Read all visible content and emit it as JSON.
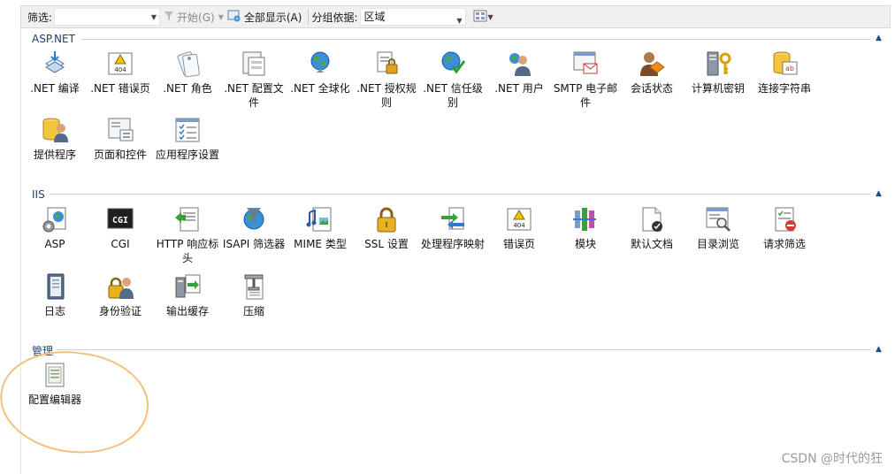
{
  "toolbar": {
    "filter_label": "筛选:",
    "filter_value": "",
    "start_label": "开始(G)",
    "show_all_label": "全部显示(A)",
    "group_label": "分组依据:",
    "group_value": "区域"
  },
  "sections": [
    {
      "title": "ASP.NET",
      "items": [
        {
          "label": ".NET 编译",
          "icon": "compile-icon"
        },
        {
          "label": ".NET 错误页",
          "icon": "error-page-404-icon"
        },
        {
          "label": ".NET 角色",
          "icon": "roles-icon"
        },
        {
          "label": ".NET 配置文件",
          "icon": "profile-icon"
        },
        {
          "label": ".NET 全球化",
          "icon": "globe-icon"
        },
        {
          "label": ".NET 授权规则",
          "icon": "authorization-icon"
        },
        {
          "label": ".NET 信任级别",
          "icon": "trust-level-icon"
        },
        {
          "label": ".NET 用户",
          "icon": "users-icon"
        },
        {
          "label": "SMTP 电子邮件",
          "icon": "smtp-email-icon"
        },
        {
          "label": "会话状态",
          "icon": "session-state-icon"
        },
        {
          "label": "计算机密钥",
          "icon": "machine-key-icon"
        },
        {
          "label": "连接字符串",
          "icon": "connection-string-icon"
        },
        {
          "label": "提供程序",
          "icon": "providers-icon"
        },
        {
          "label": "页面和控件",
          "icon": "pages-controls-icon"
        },
        {
          "label": "应用程序设置",
          "icon": "app-settings-icon"
        }
      ]
    },
    {
      "title": "IIS",
      "items": [
        {
          "label": "ASP",
          "icon": "asp-icon"
        },
        {
          "label": "CGI",
          "icon": "cgi-icon"
        },
        {
          "label": "HTTP 响应标头",
          "icon": "http-headers-icon"
        },
        {
          "label": "ISAPI 筛选器",
          "icon": "isapi-filter-icon"
        },
        {
          "label": "MIME 类型",
          "icon": "mime-types-icon"
        },
        {
          "label": "SSL 设置",
          "icon": "ssl-lock-icon"
        },
        {
          "label": "处理程序映射",
          "icon": "handler-mappings-icon"
        },
        {
          "label": "错误页",
          "icon": "error-pages-404-icon"
        },
        {
          "label": "模块",
          "icon": "modules-icon"
        },
        {
          "label": "默认文档",
          "icon": "default-document-icon"
        },
        {
          "label": "目录浏览",
          "icon": "directory-browsing-icon"
        },
        {
          "label": "请求筛选",
          "icon": "request-filtering-icon"
        },
        {
          "label": "日志",
          "icon": "logging-icon"
        },
        {
          "label": "身份验证",
          "icon": "authentication-icon"
        },
        {
          "label": "输出缓存",
          "icon": "output-cache-icon"
        },
        {
          "label": "压缩",
          "icon": "compression-icon"
        }
      ]
    },
    {
      "title": "管理",
      "items": [
        {
          "label": "配置编辑器",
          "icon": "config-editor-icon"
        }
      ]
    }
  ],
  "watermark": "CSDN @时代的狂",
  "colors": {
    "section_title": "#1e3f6e",
    "highlight_circle": "#f5c07a"
  }
}
